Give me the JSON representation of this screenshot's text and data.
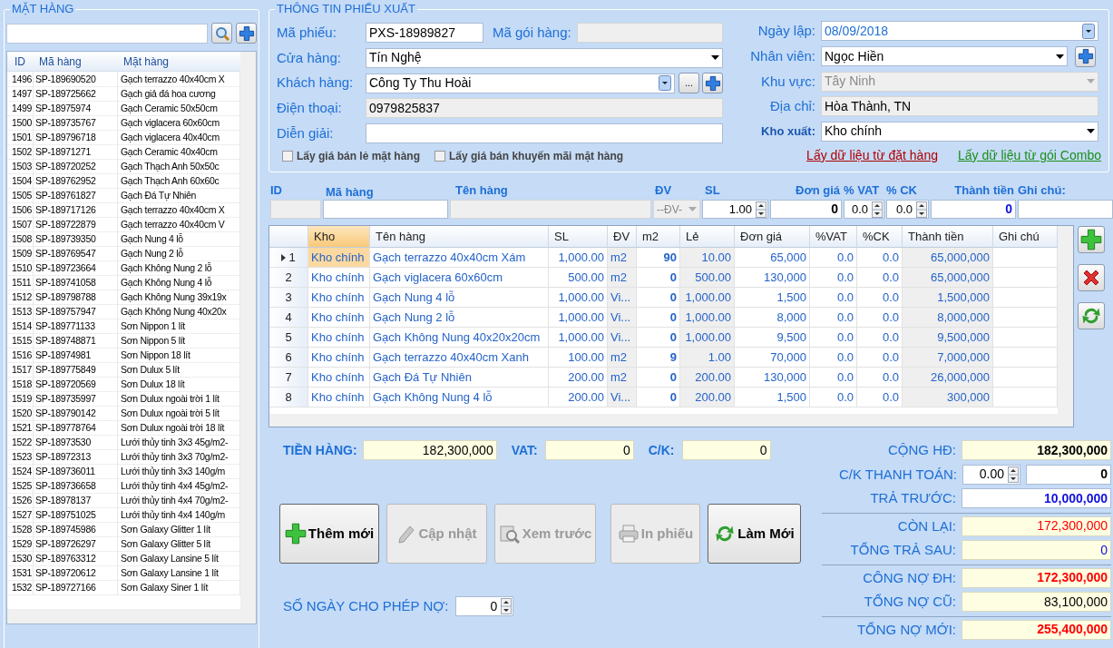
{
  "products": {
    "title": "MẶT HÀNG",
    "columns": [
      "ID",
      "Mã hàng",
      "Mặt hàng"
    ],
    "rows": [
      {
        "id": "1496",
        "code": "SP-189690520",
        "name": "Gạch terrazzo 40x40cm X"
      },
      {
        "id": "1497",
        "code": "SP-189725662",
        "name": "Gạch giả đá hoa cương"
      },
      {
        "id": "1499",
        "code": "SP-18975974",
        "name": "Gạch  Ceramic 50x50cm"
      },
      {
        "id": "1500",
        "code": "SP-189735767",
        "name": "Gạch  viglacera 60x60cm"
      },
      {
        "id": "1501",
        "code": "SP-189796718",
        "name": "Gạch  viglacera  40x40cm"
      },
      {
        "id": "1502",
        "code": "SP-18971271",
        "name": "Gạch  Ceramic 40x40cm"
      },
      {
        "id": "1503",
        "code": "SP-189720252",
        "name": "Gạch  Thạch Anh 50x50c"
      },
      {
        "id": "1504",
        "code": "SP-189762952",
        "name": "Gạch  Thạch Anh 60x60c"
      },
      {
        "id": "1505",
        "code": "SP-189761827",
        "name": "Gạch Đá Tự Nhiên"
      },
      {
        "id": "1506",
        "code": "SP-189717126",
        "name": "Gạch terrazzo 40x40cm X"
      },
      {
        "id": "1507",
        "code": "SP-189722879",
        "name": "Gạch terrazzo 40x40cm V"
      },
      {
        "id": "1508",
        "code": "SP-189739350",
        "name": "Gạch Nung 4 lỗ"
      },
      {
        "id": "1509",
        "code": "SP-189769547",
        "name": "Gạch Nung 2 lỗ"
      },
      {
        "id": "1510",
        "code": "SP-189723664",
        "name": "Gạch Không Nung 2 lỗ"
      },
      {
        "id": "1511",
        "code": "SP-189741058",
        "name": "Gạch Không Nung 4 lỗ"
      },
      {
        "id": "1512",
        "code": "SP-189798788",
        "name": "Gạch Không Nung 39x19x"
      },
      {
        "id": "1513",
        "code": "SP-189757947",
        "name": "Gạch Không Nung 40x20x"
      },
      {
        "id": "1514",
        "code": "SP-189771133",
        "name": "Sơn Nippon 1 lít"
      },
      {
        "id": "1515",
        "code": "SP-189748871",
        "name": "Sơn Nippon 5 lít"
      },
      {
        "id": "1516",
        "code": "SP-18974981",
        "name": "Sơn Nippon 18 lít"
      },
      {
        "id": "1517",
        "code": "SP-189775849",
        "name": "Sơn Dulux 5 lít"
      },
      {
        "id": "1518",
        "code": "SP-189720569",
        "name": "Sơn Dulux 18 lít"
      },
      {
        "id": "1519",
        "code": "SP-189735997",
        "name": "Sơn Dulux ngoài trời 1 lít"
      },
      {
        "id": "1520",
        "code": "SP-189790142",
        "name": "Sơn Dulux ngoài trời 5 lít"
      },
      {
        "id": "1521",
        "code": "SP-189778764",
        "name": "Sơn Dulux ngoài trời 18 lít"
      },
      {
        "id": "1522",
        "code": "SP-18973530",
        "name": "Lưới thủy tinh 3x3 45g/m2-"
      },
      {
        "id": "1523",
        "code": "SP-18972313",
        "name": "Lưới thủy tinh 3x3 70g/m2-"
      },
      {
        "id": "1524",
        "code": "SP-189736011",
        "name": "Lưới thủy tinh 3x3 140g/m"
      },
      {
        "id": "1525",
        "code": "SP-189736658",
        "name": "Lưới thủy tinh 4x4 45g/m2-"
      },
      {
        "id": "1526",
        "code": "SP-18978137",
        "name": "Lưới thủy tinh 4x4 70g/m2-"
      },
      {
        "id": "1527",
        "code": "SP-189751025",
        "name": "Lưới thủy tinh 4x4 140g/m"
      },
      {
        "id": "1528",
        "code": "SP-189745986",
        "name": "Sơn Galaxy Glitter 1 lít"
      },
      {
        "id": "1529",
        "code": "SP-189726297",
        "name": "Sơn Galaxy Glitter 5 lít"
      },
      {
        "id": "1530",
        "code": "SP-189763312",
        "name": "Sơn Galaxy Lansine 5 lít"
      },
      {
        "id": "1531",
        "code": "SP-189720612",
        "name": "Sơn Galaxy Lansine 1 lít"
      },
      {
        "id": "1532",
        "code": "SP-189727166",
        "name": "Sơn Galaxy Siner 1 lít"
      }
    ]
  },
  "voucher": {
    "title": "THÔNG TIN PHIẾU XUẤT",
    "left_rows": [
      {
        "fields": [
          {
            "label": "Mã phiếu:",
            "kind": "text",
            "value": "PXS-18989827"
          },
          {
            "label": "Mã gói hàng:",
            "kind": "readonly"
          }
        ]
      },
      {
        "fields": [
          {
            "label": "Cửa hàng:",
            "kind": "select",
            "value": "Tín Nghệ"
          }
        ]
      },
      {
        "fields": [
          {
            "label": "Khách hàng:",
            "kind": "combo",
            "value": "Công Ty Thu Hoài",
            "more": "..."
          }
        ]
      },
      {
        "fields": [
          {
            "label": "Điện thoại:",
            "kind": "readonly",
            "value": "0979825837"
          }
        ]
      },
      {
        "fields": [
          {
            "label": "Diễn giải:",
            "kind": "text"
          }
        ]
      }
    ],
    "checkboxes": [
      {
        "label": "Lấy giá bán lẻ mặt hàng",
        "checked": false
      },
      {
        "label": "Lấy giá bán khuyến mãi mặt hàng",
        "checked": false
      }
    ],
    "right_fields": [
      {
        "label": "Ngày lập:",
        "kind": "date",
        "value": "08/09/2018",
        "bold": false
      },
      {
        "label": "Nhân viên:",
        "kind": "select_add",
        "value": "Ngọc Hiền",
        "bold": false
      },
      {
        "label": "Khu vực:",
        "kind": "disabled_select",
        "value": "Tây Ninh",
        "bold": false
      },
      {
        "label": "Địa chỉ:",
        "kind": "readonly",
        "value": "Hòa Thành, TN",
        "bold": false
      },
      {
        "label": "Kho xuất:",
        "kind": "select",
        "value": "Kho chính",
        "bold": true
      }
    ],
    "links": [
      {
        "label": "Lấy dữ liệu từ đặt hàng",
        "color": "#b00000"
      },
      {
        "label": "Lấy dữ liệu từ gói Combo",
        "color": "#1a8f1a"
      }
    ]
  },
  "entry": [
    {
      "label": "ID",
      "kind": "readonly"
    },
    {
      "label": "Mã hàng",
      "kind": "text"
    },
    {
      "label": "Tên hàng",
      "kind": "readonly"
    },
    {
      "label": "ĐV",
      "kind": "select",
      "value": "--ĐV-"
    },
    {
      "label": "SL",
      "kind": "spin",
      "value": "1.00"
    },
    {
      "label": "Đơn giá",
      "kind": "amount",
      "value": "0"
    },
    {
      "label": "% VAT",
      "kind": "spin",
      "value": "0.0"
    },
    {
      "label": "% CK",
      "kind": "spin",
      "value": "0.0"
    },
    {
      "label": "Thành tiền",
      "kind": "total",
      "value": "0"
    },
    {
      "label": "Ghi chú:",
      "kind": "text"
    }
  ],
  "grid": {
    "columns": [
      {
        "label": "Kho",
        "selected": true
      },
      {
        "label": "Tên hàng",
        "selected": false
      },
      {
        "label": "SL",
        "selected": false
      },
      {
        "label": "ĐV",
        "selected": false
      },
      {
        "label": "m2",
        "selected": false
      },
      {
        "label": "Lẻ",
        "selected": false
      },
      {
        "label": "Đơn giá",
        "selected": false
      },
      {
        "label": "%VAT",
        "selected": false
      },
      {
        "label": "%CK",
        "selected": false
      },
      {
        "label": "Thành tiền",
        "selected": false
      },
      {
        "label": "Ghi chú",
        "selected": false
      }
    ],
    "rows": [
      {
        "num": "1",
        "selected": true,
        "cells": [
          "Kho chính",
          "Gạch terrazzo 40x40cm Xám",
          "1,000.00",
          "m2",
          "90",
          "10.00",
          "65,000",
          "0.0",
          "0.0",
          "65,000,000"
        ]
      },
      {
        "num": "2",
        "selected": false,
        "cells": [
          "Kho chính",
          "Gạch  viglacera 60x60cm",
          "500.00",
          "m2",
          "0",
          "500.00",
          "130,000",
          "0.0",
          "0.0",
          "65,000,000"
        ]
      },
      {
        "num": "3",
        "selected": false,
        "cells": [
          "Kho chính",
          "Gạch Nung 4 lỗ",
          "1,000.00",
          "Vi...",
          "0",
          "1,000.00",
          "1,500",
          "0.0",
          "0.0",
          "1,500,000"
        ]
      },
      {
        "num": "4",
        "selected": false,
        "cells": [
          "Kho chính",
          "Gạch Nung 2 lỗ",
          "1,000.00",
          "Vi...",
          "0",
          "1,000.00",
          "8,000",
          "0.0",
          "0.0",
          "8,000,000"
        ]
      },
      {
        "num": "5",
        "selected": false,
        "cells": [
          "Kho chính",
          "Gạch Không Nung 40x20x20cm",
          "1,000.00",
          "Vi...",
          "0",
          "1,000.00",
          "9,500",
          "0.0",
          "0.0",
          "9,500,000"
        ]
      },
      {
        "num": "6",
        "selected": false,
        "cells": [
          "Kho chính",
          "Gạch terrazzo 40x40cm Xanh",
          "100.00",
          "m2",
          "9",
          "1.00",
          "70,000",
          "0.0",
          "0.0",
          "7,000,000"
        ]
      },
      {
        "num": "7",
        "selected": false,
        "cells": [
          "Kho chính",
          "Gạch Đá Tự Nhiên",
          "200.00",
          "m2",
          "0",
          "200.00",
          "130,000",
          "0.0",
          "0.0",
          "26,000,000"
        ]
      },
      {
        "num": "8",
        "selected": false,
        "cells": [
          "Kho chính",
          "Gạch Không Nung 4 lỗ",
          "200.00",
          "Vi...",
          "0",
          "200.00",
          "1,500",
          "0.0",
          "0.0",
          "300,000"
        ]
      }
    ],
    "side_buttons": [
      {
        "kind": "add"
      },
      {
        "kind": "delete"
      },
      {
        "kind": "refresh"
      }
    ]
  },
  "summary": [
    {
      "label": "TIỀN HÀNG:",
      "value": "182,300,000"
    },
    {
      "label": "VAT:",
      "value": "0"
    },
    {
      "label": "C/K:",
      "value": "0"
    }
  ],
  "buttons": [
    {
      "label": "Thêm mới",
      "kind": "add",
      "disabled": false
    },
    {
      "label": "Cập nhật",
      "kind": "edit",
      "disabled": true
    },
    {
      "label": "Xem trước",
      "kind": "preview",
      "disabled": true
    },
    {
      "label": "In phiếu",
      "kind": "print",
      "disabled": true
    },
    {
      "label": "Làm Mới",
      "kind": "refresh",
      "disabled": false
    }
  ],
  "debt_days": {
    "label": "SỐ NGÀY CHO PHÉP NỢ:",
    "value": "0"
  },
  "totals": [
    {
      "rows": [
        {
          "label": "CỘNG HĐ:",
          "kind": "readonly",
          "value": "182,300,000",
          "color": "#000000",
          "bold": true
        },
        {
          "label": "C/K THANH TOÁN:",
          "kind": "discount",
          "rate": "0.00",
          "value": "0",
          "color": "#000000",
          "bold": true
        },
        {
          "label": "TRẢ TRƯỚC:",
          "kind": "input",
          "value": "10,000,000",
          "color": "#1010e0",
          "bold": true
        }
      ]
    },
    {
      "rows": [
        {
          "label": "CÒN LẠI:",
          "kind": "readonly",
          "value": "172,300,000",
          "color": "#ff0000",
          "bold": false
        },
        {
          "label": "TỔNG TRẢ SAU:",
          "kind": "readonly",
          "value": "0",
          "color": "#1010e0",
          "bold": false
        }
      ]
    },
    {
      "rows": [
        {
          "label": "CÔNG NỢ ĐH:",
          "kind": "readonly",
          "value": "172,300,000",
          "color": "#ff0000",
          "bold": true
        },
        {
          "label": "TỔNG NỢ CŨ:",
          "kind": "readonly",
          "value": "83,100,000",
          "color": "#000000",
          "bold": false
        }
      ]
    },
    {
      "rows": [
        {
          "label": "TỔNG NỢ MỚI:",
          "kind": "readonly",
          "value": "255,400,000",
          "color": "#ff0000",
          "bold": true
        }
      ]
    }
  ]
}
